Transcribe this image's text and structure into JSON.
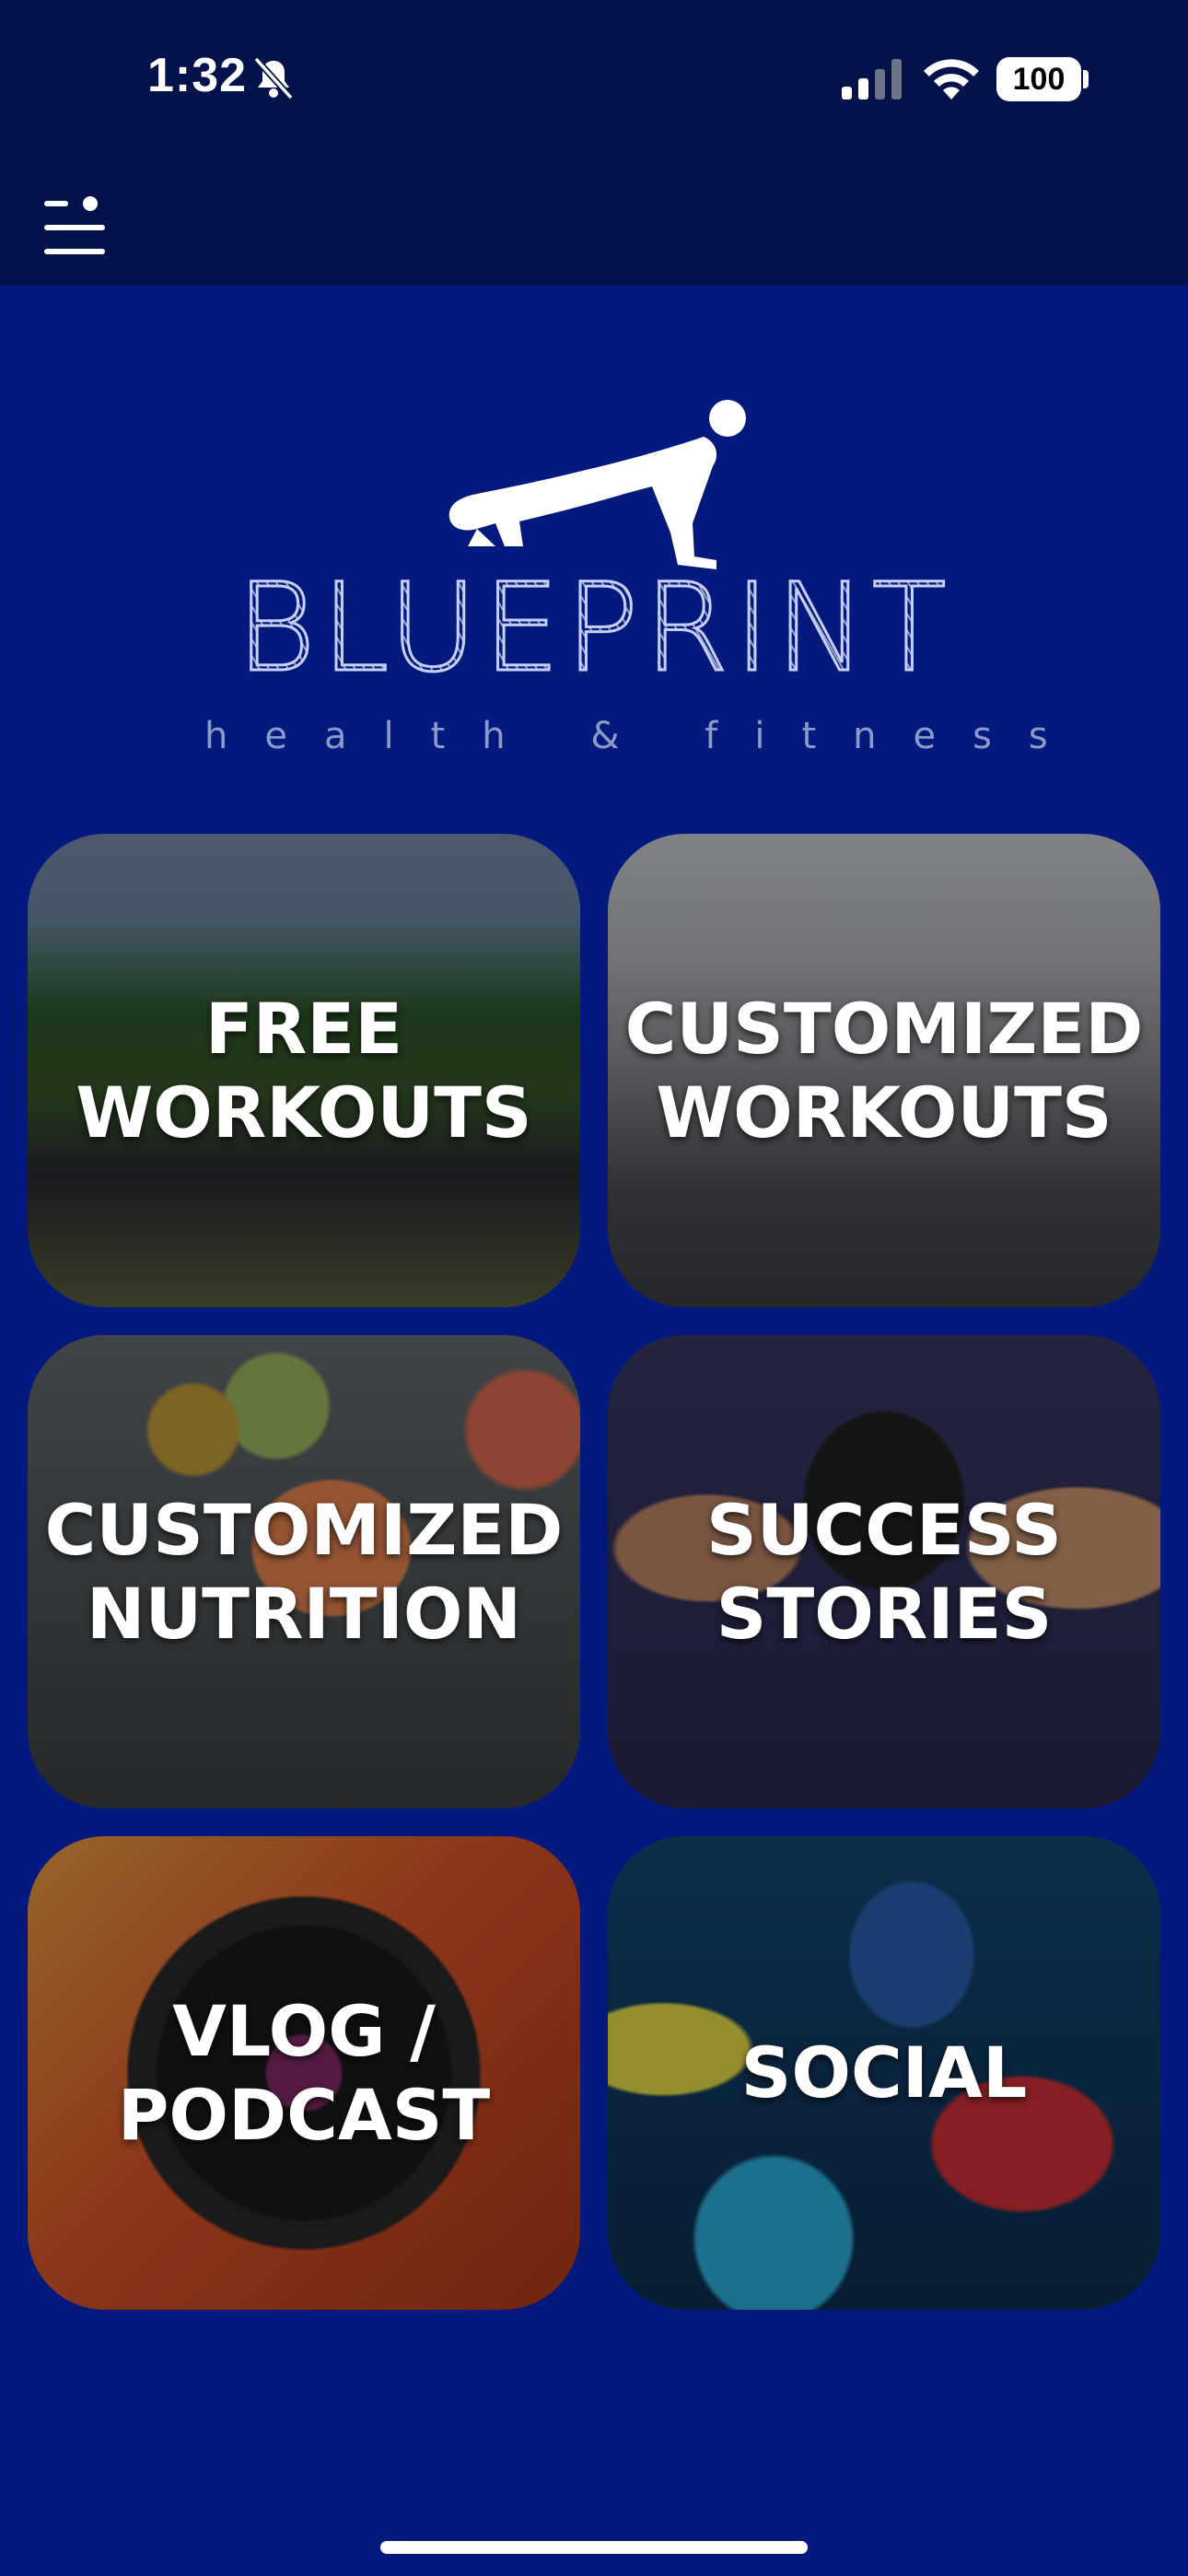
{
  "status_bar": {
    "time": "1:32",
    "battery": "100",
    "icons": [
      "bell-slash-icon",
      "cellular-signal-icon",
      "wifi-icon",
      "battery-icon"
    ]
  },
  "header": {
    "menu_icon": "menu-icon"
  },
  "logo": {
    "brand": "BLUEPRINT",
    "tagline": "health & fitness",
    "figure_icon": "pushup-figure-icon"
  },
  "tiles": [
    {
      "label": "FREE\nWORKOUTS"
    },
    {
      "label": "CUSTOMIZED\nWORKOUTS"
    },
    {
      "label": "CUSTOMIZED\nNUTRITION"
    },
    {
      "label": "SUCCESS\nSTORIES"
    },
    {
      "label": "VLOG /\nPODCAST"
    },
    {
      "label": "SOCIAL"
    }
  ],
  "colors": {
    "background": "#04197d",
    "header": "#03124a",
    "text": "#ffffff"
  }
}
